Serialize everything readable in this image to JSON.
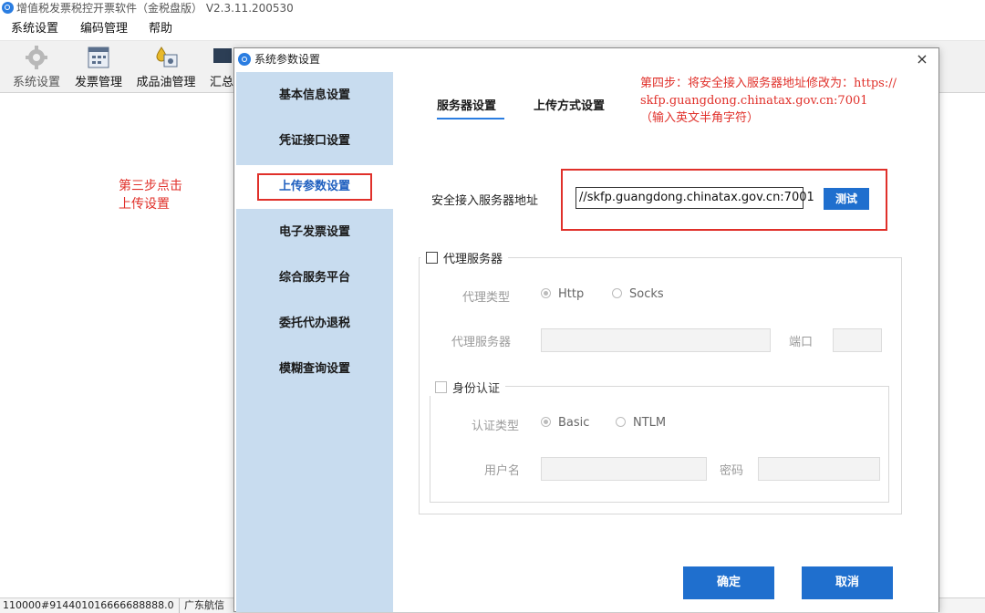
{
  "window": {
    "title": "增值税发票税控开票软件（金税盘版） V2.3.11.200530"
  },
  "menubar": {
    "items": [
      "系统设置",
      "编码管理",
      "帮助"
    ]
  },
  "toolbar": {
    "items": [
      {
        "label": "系统设置",
        "icon": "gear-icon"
      },
      {
        "label": "发票管理",
        "icon": "invoice-icon"
      },
      {
        "label": "成品油管理",
        "icon": "oil-icon"
      },
      {
        "label": "汇总",
        "icon": "summary-icon"
      }
    ]
  },
  "statusbar": {
    "taxid": "110000#914401016666688888.0",
    "region": "广东航信"
  },
  "annotations": {
    "step3_line1": "第三步点击",
    "step3_line2": "上传设置",
    "step4_line1": "第四步：将安全接入服务器地址修改为：https://",
    "step4_line2": "skfp.guangdong.chinatax.gov.cn:7001",
    "step4_line3": "（输入英文半角字符）"
  },
  "dialog": {
    "title": "系统参数设置",
    "close": "×",
    "sidebar": [
      {
        "label": "基本信息设置",
        "active": false
      },
      {
        "label": "凭证接口设置",
        "active": false
      },
      {
        "label": "上传参数设置",
        "active": true
      },
      {
        "label": "电子发票设置",
        "active": false
      },
      {
        "label": "综合服务平台",
        "active": false
      },
      {
        "label": "委托代办退税",
        "active": false
      },
      {
        "label": "模糊查询设置",
        "active": false
      }
    ],
    "tabs": [
      {
        "label": "服务器设置",
        "active": true
      },
      {
        "label": "上传方式设置",
        "active": false
      }
    ],
    "server": {
      "label": "安全接入服务器地址",
      "value": "//skfp.guangdong.chinatax.gov.cn:7001",
      "test_label": "测试"
    },
    "proxy": {
      "legend": "代理服务器",
      "checked": false,
      "type_label": "代理类型",
      "type_options": [
        "Http",
        "Socks"
      ],
      "type_selected": "Http",
      "server_label": "代理服务器",
      "port_label": "端口"
    },
    "auth": {
      "legend": "身份认证",
      "checked": false,
      "type_label": "认证类型",
      "type_options": [
        "Basic",
        "NTLM"
      ],
      "type_selected": "Basic",
      "user_label": "用户名",
      "password_label": "密码"
    },
    "ok_label": "确定",
    "cancel_label": "取消"
  },
  "colors": {
    "accent": "#1f6fce",
    "sidebar_bg": "#c8dcef",
    "annotation": "#e0302a"
  }
}
